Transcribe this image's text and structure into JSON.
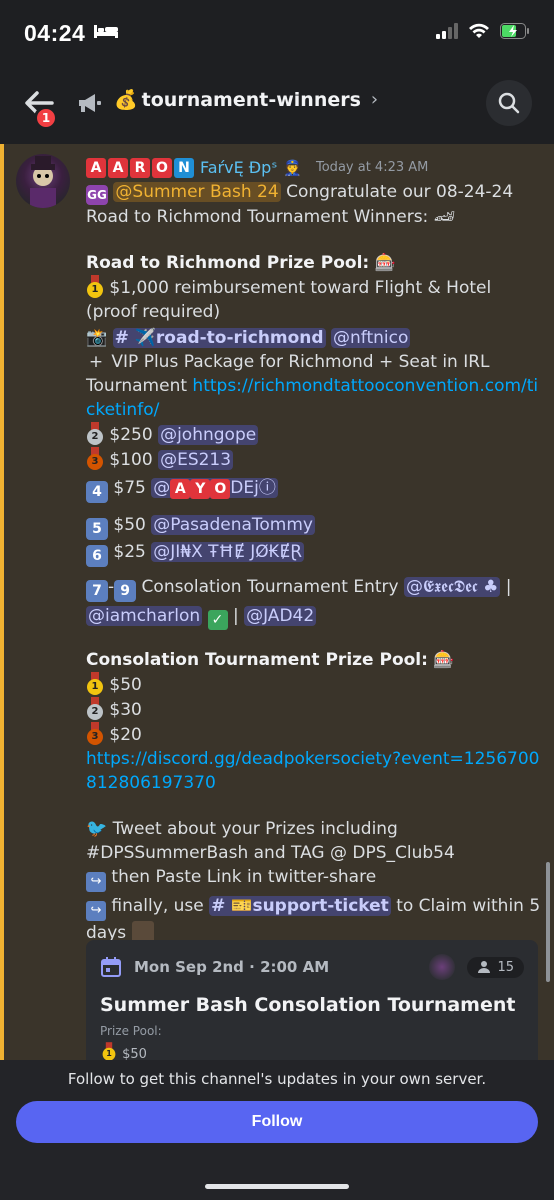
{
  "status_bar": {
    "time": "04:24"
  },
  "header": {
    "notification_count": "1",
    "channel_emoji": "💰",
    "channel_name": "tournament-winners",
    "chevron": "›"
  },
  "message": {
    "author_letters": [
      "A",
      "A",
      "R",
      "O",
      "N"
    ],
    "author_suffix": "FaŕvĘ Đpˢ",
    "author_badge": "👮",
    "timestamp": "Today at 4:23 AM",
    "role_badge": "GG",
    "role_mention": "@Summer Bash 24",
    "intro_text": "Congratulate our 08-24-24 Road to Richmond Tournament Winners:",
    "intro_emoji": "🏎",
    "prize_pool_title": "Road to Richmond Prize Pool:",
    "prize_pool_emoji": "🎰",
    "first_place_text": "$1,000 reimbursement toward Flight & Hotel (proof required)",
    "first_channel_emoji": "📸",
    "first_channel": "# ✈️road-to-richmond",
    "first_winner": "@nftnico",
    "plus_symbol": "+",
    "vip_text": "VIP Plus Package for Richmond + Seat in IRL Tournament",
    "vip_link": "https://richmondtattooconvention.com/ticketinfo/",
    "second_amount": "$250",
    "second_winner": "@johngope",
    "third_amount": "$100",
    "third_winner": "@ES213",
    "fourth_key": "4",
    "fourth_amount": "$75",
    "fourth_winner_prefix": "@",
    "fourth_winner_letters": [
      "A",
      "Y",
      "O"
    ],
    "fourth_winner_suffix": "DEjⓘ",
    "fifth_key": "5",
    "fifth_amount": "$50",
    "fifth_winner": "@PasadenaTommy",
    "sixth_key": "6",
    "sixth_amount": "$25",
    "sixth_winner": "@JI₦X ŦĦɆ JØ₭ɆⱤ",
    "seventh_key": "7",
    "dash": "-",
    "ninth_key": "9",
    "consolation_entry_text": "Consolation Tournament Entry",
    "consolation_winner_1": "@𝕰𝖝𝖊𝖈𝕯𝖊𝖈",
    "club_suit": "♣",
    "separator": "|",
    "consolation_winner_2": "@iamcharlon",
    "check_symbol": "✓",
    "consolation_winner_3": "@JAD42",
    "consolation_pool_title": "Consolation Tournament Prize Pool:",
    "consolation_pool_emoji": "🎰",
    "consolation_first": "$50",
    "consolation_second": "$30",
    "consolation_third": "$20",
    "event_link": "https://discord.gg/deadpokersociety?event=1256700812806197370",
    "tweet_text": "Tweet about your Prizes including #DPSSummerBash and TAG @ DPS_Club54",
    "paste_text": "then Paste Link in",
    "twitter_channel": "twitter-share",
    "finally_text": "finally, use",
    "support_channel": "# 🎫support-ticket",
    "claim_text": "to Claim within 5 days",
    "medals": {
      "gold": "1",
      "silver": "2",
      "bronze": "3"
    }
  },
  "event_card": {
    "date": "Mon Sep 2nd · 2:00 AM",
    "interested_count": "15",
    "title": "Summer Bash Consolation Tournament",
    "subtitle": "Prize Pool:",
    "prize": "$50"
  },
  "footer": {
    "follow_text": "Follow to get this channel's updates in your own server.",
    "follow_label": "Follow"
  },
  "colors": {
    "accent": "#5865f2",
    "mention_bg": "#3a342a",
    "mention_bar": "#f0b232",
    "link": "#00a8fc",
    "badge_red": "#f23f43"
  },
  "icons": [
    "back-arrow-icon",
    "megaphone-icon",
    "search-icon",
    "bed-icon",
    "signal-icon",
    "wifi-icon",
    "battery-icon",
    "calendar-icon",
    "people-icon"
  ]
}
